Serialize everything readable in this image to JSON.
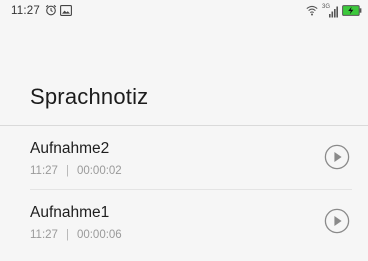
{
  "status_bar": {
    "time": "11:27",
    "left_icons": [
      "alarm-icon",
      "image-notification-icon"
    ],
    "right_icons": [
      "wifi-icon",
      "signal-icon",
      "battery-charging-icon"
    ],
    "network_label": "3G",
    "battery_color": "#3cc93c"
  },
  "page": {
    "title": "Sprachnotiz"
  },
  "recordings": [
    {
      "name": "Aufnahme2",
      "time": "11:27",
      "separator": "|",
      "duration": "00:00:02"
    },
    {
      "name": "Aufnahme1",
      "time": "11:27",
      "separator": "|",
      "duration": "00:00:06"
    }
  ],
  "colors": {
    "background": "#f6f6f6",
    "title": "#1c1c1c",
    "meta": "#9a9a9a",
    "play_icon": "#8a8a8a"
  }
}
